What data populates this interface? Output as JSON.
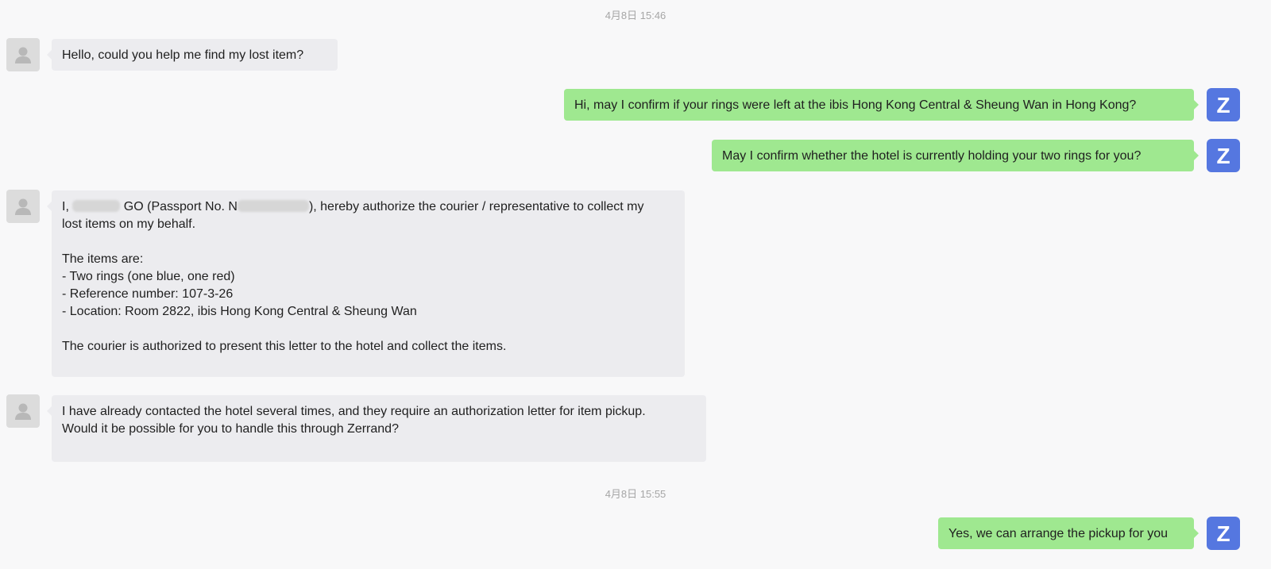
{
  "timestamps": [
    "4月8日 15:46",
    "4月8日 15:55"
  ],
  "icons": {
    "user_avatar": "person-silhouette-icon",
    "agent_avatar": "z-logo-icon"
  },
  "colors": {
    "incoming_bubble": "#ececef",
    "outgoing_bubble": "#9fe890",
    "agent_avatar": "#5577e0",
    "user_avatar": "#dcdcdc"
  },
  "agent_avatar_letter": "Z",
  "messages": [
    {
      "from": "user",
      "text": "Hello, could you help me find my lost item?"
    },
    {
      "from": "agent",
      "text": "Hi, may I confirm if your rings were left at the ibis Hong Kong Central & Sheung Wan in Hong Kong?"
    },
    {
      "from": "agent",
      "text": "May I confirm whether the hotel is currently holding your two rings for you?"
    },
    {
      "from": "user",
      "line1_a": "I, ",
      "line1_b": " GO (Passport No. N",
      "line1_c": "), hereby authorize the courier / representative to collect my",
      "line2": "lost items on my behalf.",
      "line3": "The items are:",
      "line4": "- Two rings (one blue, one red)",
      "line5": "- Reference number: 107-3-26",
      "line6": "- Location: Room 2822, ibis Hong Kong Central & Sheung Wan",
      "line7": "The courier is authorized to present this letter to the hotel and collect the items."
    },
    {
      "from": "user",
      "line1": "I have already contacted the hotel several times, and they require an authorization letter for item pickup.",
      "line2": "Would it be possible for you to handle this through Zerrand?"
    },
    {
      "from": "agent",
      "text": "Yes, we can arrange the pickup for you"
    }
  ]
}
